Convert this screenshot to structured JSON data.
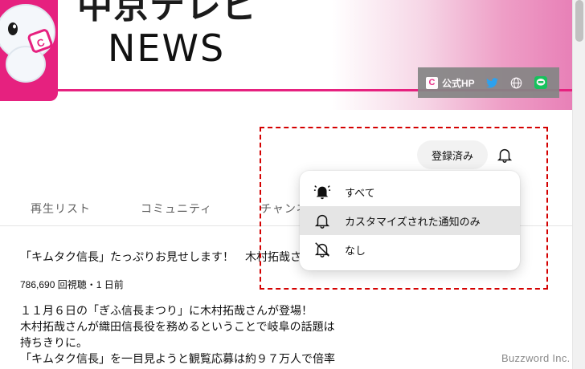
{
  "banner": {
    "brand_jp": "中京テレビ",
    "brand_news": "NEWS",
    "links": {
      "official_logo": "C",
      "official_label": "公式HP",
      "icons": [
        "twitter-icon",
        "globe-icon",
        "line-icon"
      ]
    },
    "accent_color": "#e6217f"
  },
  "channel": {
    "subscribed_label": "登録済み"
  },
  "tabs": [
    "再生リスト",
    "コミュニティ",
    "チャンネル"
  ],
  "notification_menu": {
    "items": [
      {
        "label": "すべて",
        "icon": "bell-ring-filled-icon",
        "selected": false
      },
      {
        "label": "カスタマイズされた通知のみ",
        "icon": "bell-outline-icon",
        "selected": true
      },
      {
        "label": "なし",
        "icon": "bell-off-icon",
        "selected": false
      }
    ]
  },
  "video": {
    "title": "「キムタク信長」たっぷりお見せします！　木村拓哉さ",
    "meta": "786,690 回視聴・1 日前",
    "description": [
      "１１月６日の「ぎふ信長まつり」に木村拓哉さんが登場！",
      "木村拓哉さんが織田信長役を務めるということで岐阜の話題は",
      "持ちきりに。",
      "「キムタク信長」を一目見ようと観覧応募は約９７万人で倍率"
    ]
  },
  "watermark": "Buzzword Inc."
}
